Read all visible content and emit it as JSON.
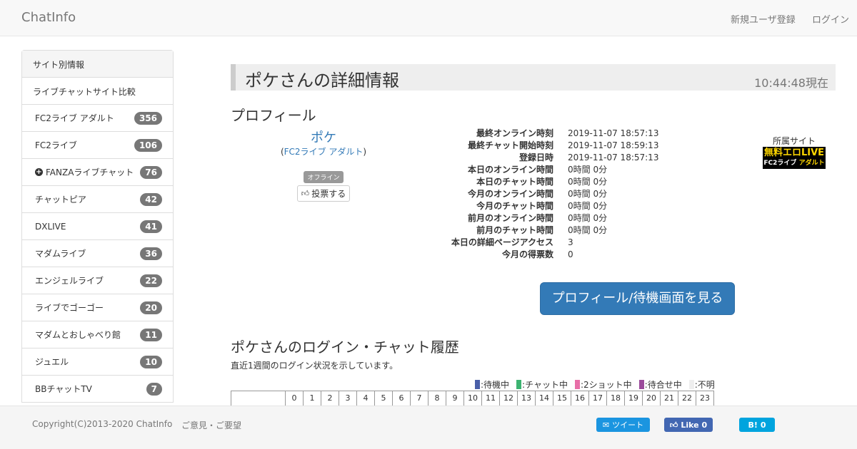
{
  "navbar": {
    "brand": "ChatInfo",
    "register": "新規ユーザ登録",
    "login": "ログイン"
  },
  "sidebar": {
    "header": "サイト別情報",
    "compare": "ライブチャットサイト比較",
    "items": [
      {
        "label": "FC2ライブ アダルト",
        "count": "356"
      },
      {
        "label": "FC2ライブ",
        "count": "106"
      },
      {
        "label": "FANZAライブチャット",
        "count": "76"
      },
      {
        "label": "チャットピア",
        "count": "42"
      },
      {
        "label": "DXLIVE",
        "count": "41"
      },
      {
        "label": "マダムライブ",
        "count": "36"
      },
      {
        "label": "エンジェルライブ",
        "count": "22"
      },
      {
        "label": "ライブでゴーゴー",
        "count": "20"
      },
      {
        "label": "マダムとおしゃべり館",
        "count": "11"
      },
      {
        "label": "ジュエル",
        "count": "10"
      },
      {
        "label": "BBチャットTV",
        "count": "7"
      }
    ]
  },
  "page": {
    "title": "ポケさんの詳細情報",
    "time": "10:44:48現在"
  },
  "profile": {
    "heading": "プロフィール",
    "name": "ポケ",
    "site_open": "(",
    "site_name": "FC2ライブ アダルト",
    "site_close": ")",
    "status": "オフライン",
    "vote": "投票する",
    "site_label": "所属サイト",
    "logo_top": "無料エロLIVE",
    "logo_bottom_a": "FC2ライブ",
    "logo_bottom_b": "アダルト",
    "view_button": "プロフィール/待機画面を見る",
    "info": [
      {
        "key": "最終オンライン時刻",
        "value": "2019-11-07 18:57:13"
      },
      {
        "key": "最終チャット開始時刻",
        "value": "2019-11-07 18:59:13"
      },
      {
        "key": "登録日時",
        "value": "2019-11-07 18:57:13"
      },
      {
        "key": "本日のオンライン時間",
        "value": "0時間 0分"
      },
      {
        "key": "本日のチャット時間",
        "value": "0時間 0分"
      },
      {
        "key": "今月のオンライン時間",
        "value": "0時間 0分"
      },
      {
        "key": "今月のチャット時間",
        "value": "0時間 0分"
      },
      {
        "key": "前月のオンライン時間",
        "value": "0時間 0分"
      },
      {
        "key": "前月のチャット時間",
        "value": "0時間 0分"
      },
      {
        "key": "本日の詳細ページアクセス",
        "value": "3"
      },
      {
        "key": "今月の得票数",
        "value": "0"
      }
    ]
  },
  "history": {
    "heading": "ポケさんのログイン・チャット履歴",
    "desc": "直近1週間のログイン状況を示しています。",
    "legend": [
      {
        "label": ":待機中",
        "color": "#4a5fa8"
      },
      {
        "label": ":チャット中",
        "color": "#3cb371"
      },
      {
        "label": ":2ショット中",
        "color": "#e86fa8"
      },
      {
        "label": ":待合せ中",
        "color": "#9b4a9b"
      },
      {
        "label": ":不明",
        "color": "#eeeeee"
      }
    ],
    "hours": [
      "0",
      "1",
      "2",
      "3",
      "4",
      "5",
      "6",
      "7",
      "8",
      "9",
      "10",
      "11",
      "12",
      "13",
      "14",
      "15",
      "16",
      "17",
      "18",
      "19",
      "20",
      "21",
      "22",
      "23"
    ]
  },
  "footer": {
    "copyright": "Copyright(C)2013-2020 ChatInfo",
    "feedback": "ご意見・ご要望",
    "tweet": "ツイート",
    "like": "Like 0",
    "hatena": "0"
  }
}
